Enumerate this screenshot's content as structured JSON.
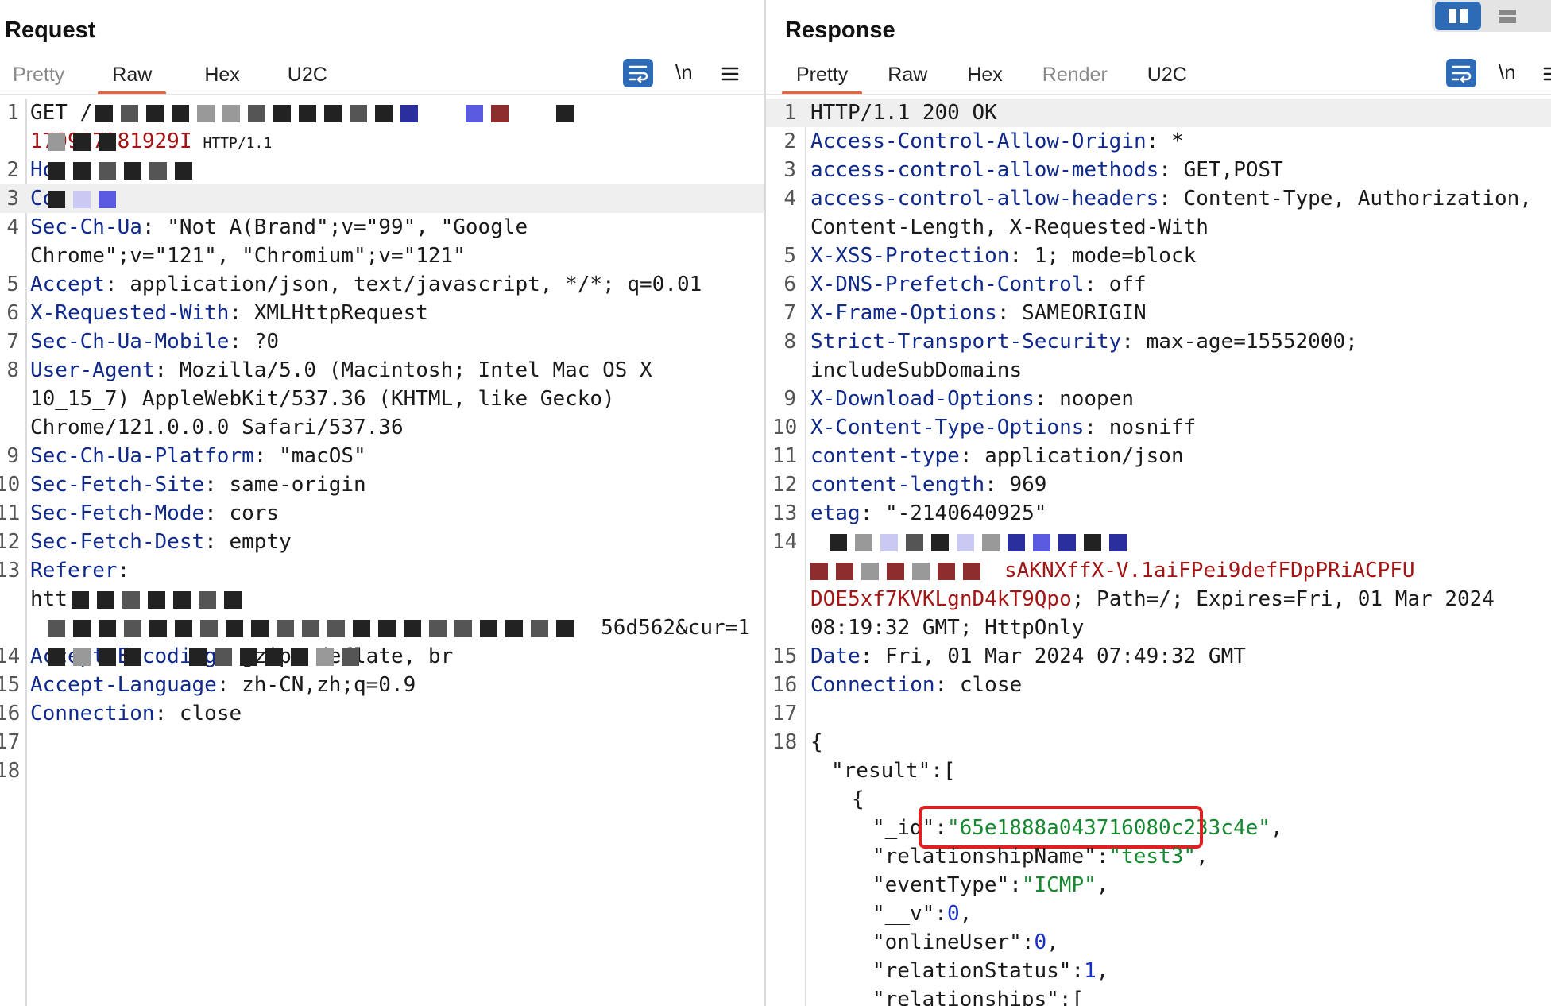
{
  "request": {
    "title": "Request",
    "tabs": [
      "Pretty",
      "Raw",
      "Hex",
      "U2C"
    ],
    "active_tab": "Raw",
    "newline_label": "\\n",
    "lines": [
      {
        "n": "1",
        "key": "GET /r",
        "val": ""
      },
      {
        "n": "",
        "key": "",
        "val": "170917281929I",
        "suffix": "HTTP/1.1"
      },
      {
        "n": "2",
        "key": "Ho",
        "val": ""
      },
      {
        "n": "3",
        "key": "Co",
        "val": ""
      },
      {
        "n": "4",
        "key": "Sec-Ch-Ua",
        "val": "\"Not A(Brand\";v=\"99\", \"Google"
      },
      {
        "n": "",
        "key": "",
        "val": "Chrome\";v=\"121\", \"Chromium\";v=\"121\""
      },
      {
        "n": "5",
        "key": "Accept",
        "val": "application/json, text/javascript, */*; q=0.01"
      },
      {
        "n": "6",
        "key": "X-Requested-With",
        "val": "XMLHttpRequest"
      },
      {
        "n": "7",
        "key": "Sec-Ch-Ua-Mobile",
        "val": "?0"
      },
      {
        "n": "8",
        "key": "User-Agent",
        "val": "Mozilla/5.0 (Macintosh; Intel Mac OS X"
      },
      {
        "n": "",
        "key": "",
        "val": "10_15_7) AppleWebKit/537.36 (KHTML, like Gecko)"
      },
      {
        "n": "",
        "key": "",
        "val": "Chrome/121.0.0.0 Safari/537.36"
      },
      {
        "n": "9",
        "key": "Sec-Ch-Ua-Platform",
        "val": "\"macOS\""
      },
      {
        "n": "10",
        "key": "Sec-Fetch-Site",
        "val": "same-origin"
      },
      {
        "n": "11",
        "key": "Sec-Fetch-Mode",
        "val": "cors"
      },
      {
        "n": "12",
        "key": "Sec-Fetch-Dest",
        "val": "empty"
      },
      {
        "n": "13",
        "key": "Referer",
        "val": ""
      },
      {
        "n": "",
        "key": "",
        "val": "htt"
      },
      {
        "n": "",
        "key": "",
        "val": "56d562&cur=1"
      },
      {
        "n": "14",
        "key": "Accept-Encoding",
        "val": "gzip, deflate, br"
      },
      {
        "n": "15",
        "key": "Accept-Language",
        "val": "zh-CN,zh;q=0.9"
      },
      {
        "n": "16",
        "key": "Connection",
        "val": "close"
      },
      {
        "n": "17",
        "key": "",
        "val": ""
      },
      {
        "n": "18",
        "key": "",
        "val": ""
      }
    ]
  },
  "response": {
    "title": "Response",
    "tabs": [
      "Pretty",
      "Raw",
      "Hex",
      "Render",
      "U2C"
    ],
    "active_tab": "Pretty",
    "newline_label": "\\n",
    "status_line": "HTTP/1.1 200 OK",
    "headers": [
      {
        "n": "2",
        "key": "Access-Control-Allow-Origin",
        "val": "*"
      },
      {
        "n": "3",
        "key": "access-control-allow-methods",
        "val": "GET,POST"
      },
      {
        "n": "4",
        "key": "access-control-allow-headers",
        "val": "Content-Type, Authorization,"
      },
      {
        "n": "",
        "key": "",
        "val": "Content-Length, X-Requested-With"
      },
      {
        "n": "5",
        "key": "X-XSS-Protection",
        "val": "1; mode=block"
      },
      {
        "n": "6",
        "key": "X-DNS-Prefetch-Control",
        "val": "off"
      },
      {
        "n": "7",
        "key": "X-Frame-Options",
        "val": "SAMEORIGIN"
      },
      {
        "n": "8",
        "key": "Strict-Transport-Security",
        "val": "max-age=15552000;"
      },
      {
        "n": "",
        "key": "",
        "val": "includeSubDomains"
      },
      {
        "n": "9",
        "key": "X-Download-Options",
        "val": "noopen"
      },
      {
        "n": "10",
        "key": "X-Content-Type-Options",
        "val": "nosniff"
      },
      {
        "n": "11",
        "key": "content-type",
        "val": "application/json"
      },
      {
        "n": "12",
        "key": "content-length",
        "val": "969"
      },
      {
        "n": "13",
        "key": "etag",
        "val": "\"-2140640925\""
      }
    ],
    "cookie_line_n": "14",
    "cookie_tail_red": "sAKNXffX-V.1aiFPei9defFDpPRiACPFU",
    "cookie_cont_red": "DOE5xf7KVKLgnD4kT9Qpo",
    "cookie_cont_rest": "; Path=/; Expires=Fri, 01 Mar 2024",
    "cookie_cont2": "08:19:32 GMT; HttpOnly",
    "date": {
      "n": "15",
      "key": "Date",
      "val": "Fri, 01 Mar 2024 07:49:32 GMT"
    },
    "connection": {
      "n": "16",
      "key": "Connection",
      "val": "close"
    },
    "blank_n": "17",
    "body_n": "18",
    "body": {
      "open_brace": "{",
      "result_key": "\"result\"",
      "result_open": ":[",
      "item_open": "{",
      "fields": [
        {
          "key": "\"_id\"",
          "val": "\"65e1888a043716080c233c4e\"",
          "type": "str"
        },
        {
          "key": "\"relationshipName\"",
          "val": "\"test3\"",
          "type": "str"
        },
        {
          "key": "\"eventType\"",
          "val": "\"ICMP\"",
          "type": "str"
        },
        {
          "key": "\"__v\"",
          "val": "0",
          "type": "num"
        },
        {
          "key": "\"onlineUser\"",
          "val": "0",
          "type": "num"
        },
        {
          "key": "\"relationStatus\"",
          "val": "1",
          "type": "num"
        },
        {
          "key": "\"relationships\"",
          "val": "[",
          "type": "plain"
        }
      ]
    }
  }
}
